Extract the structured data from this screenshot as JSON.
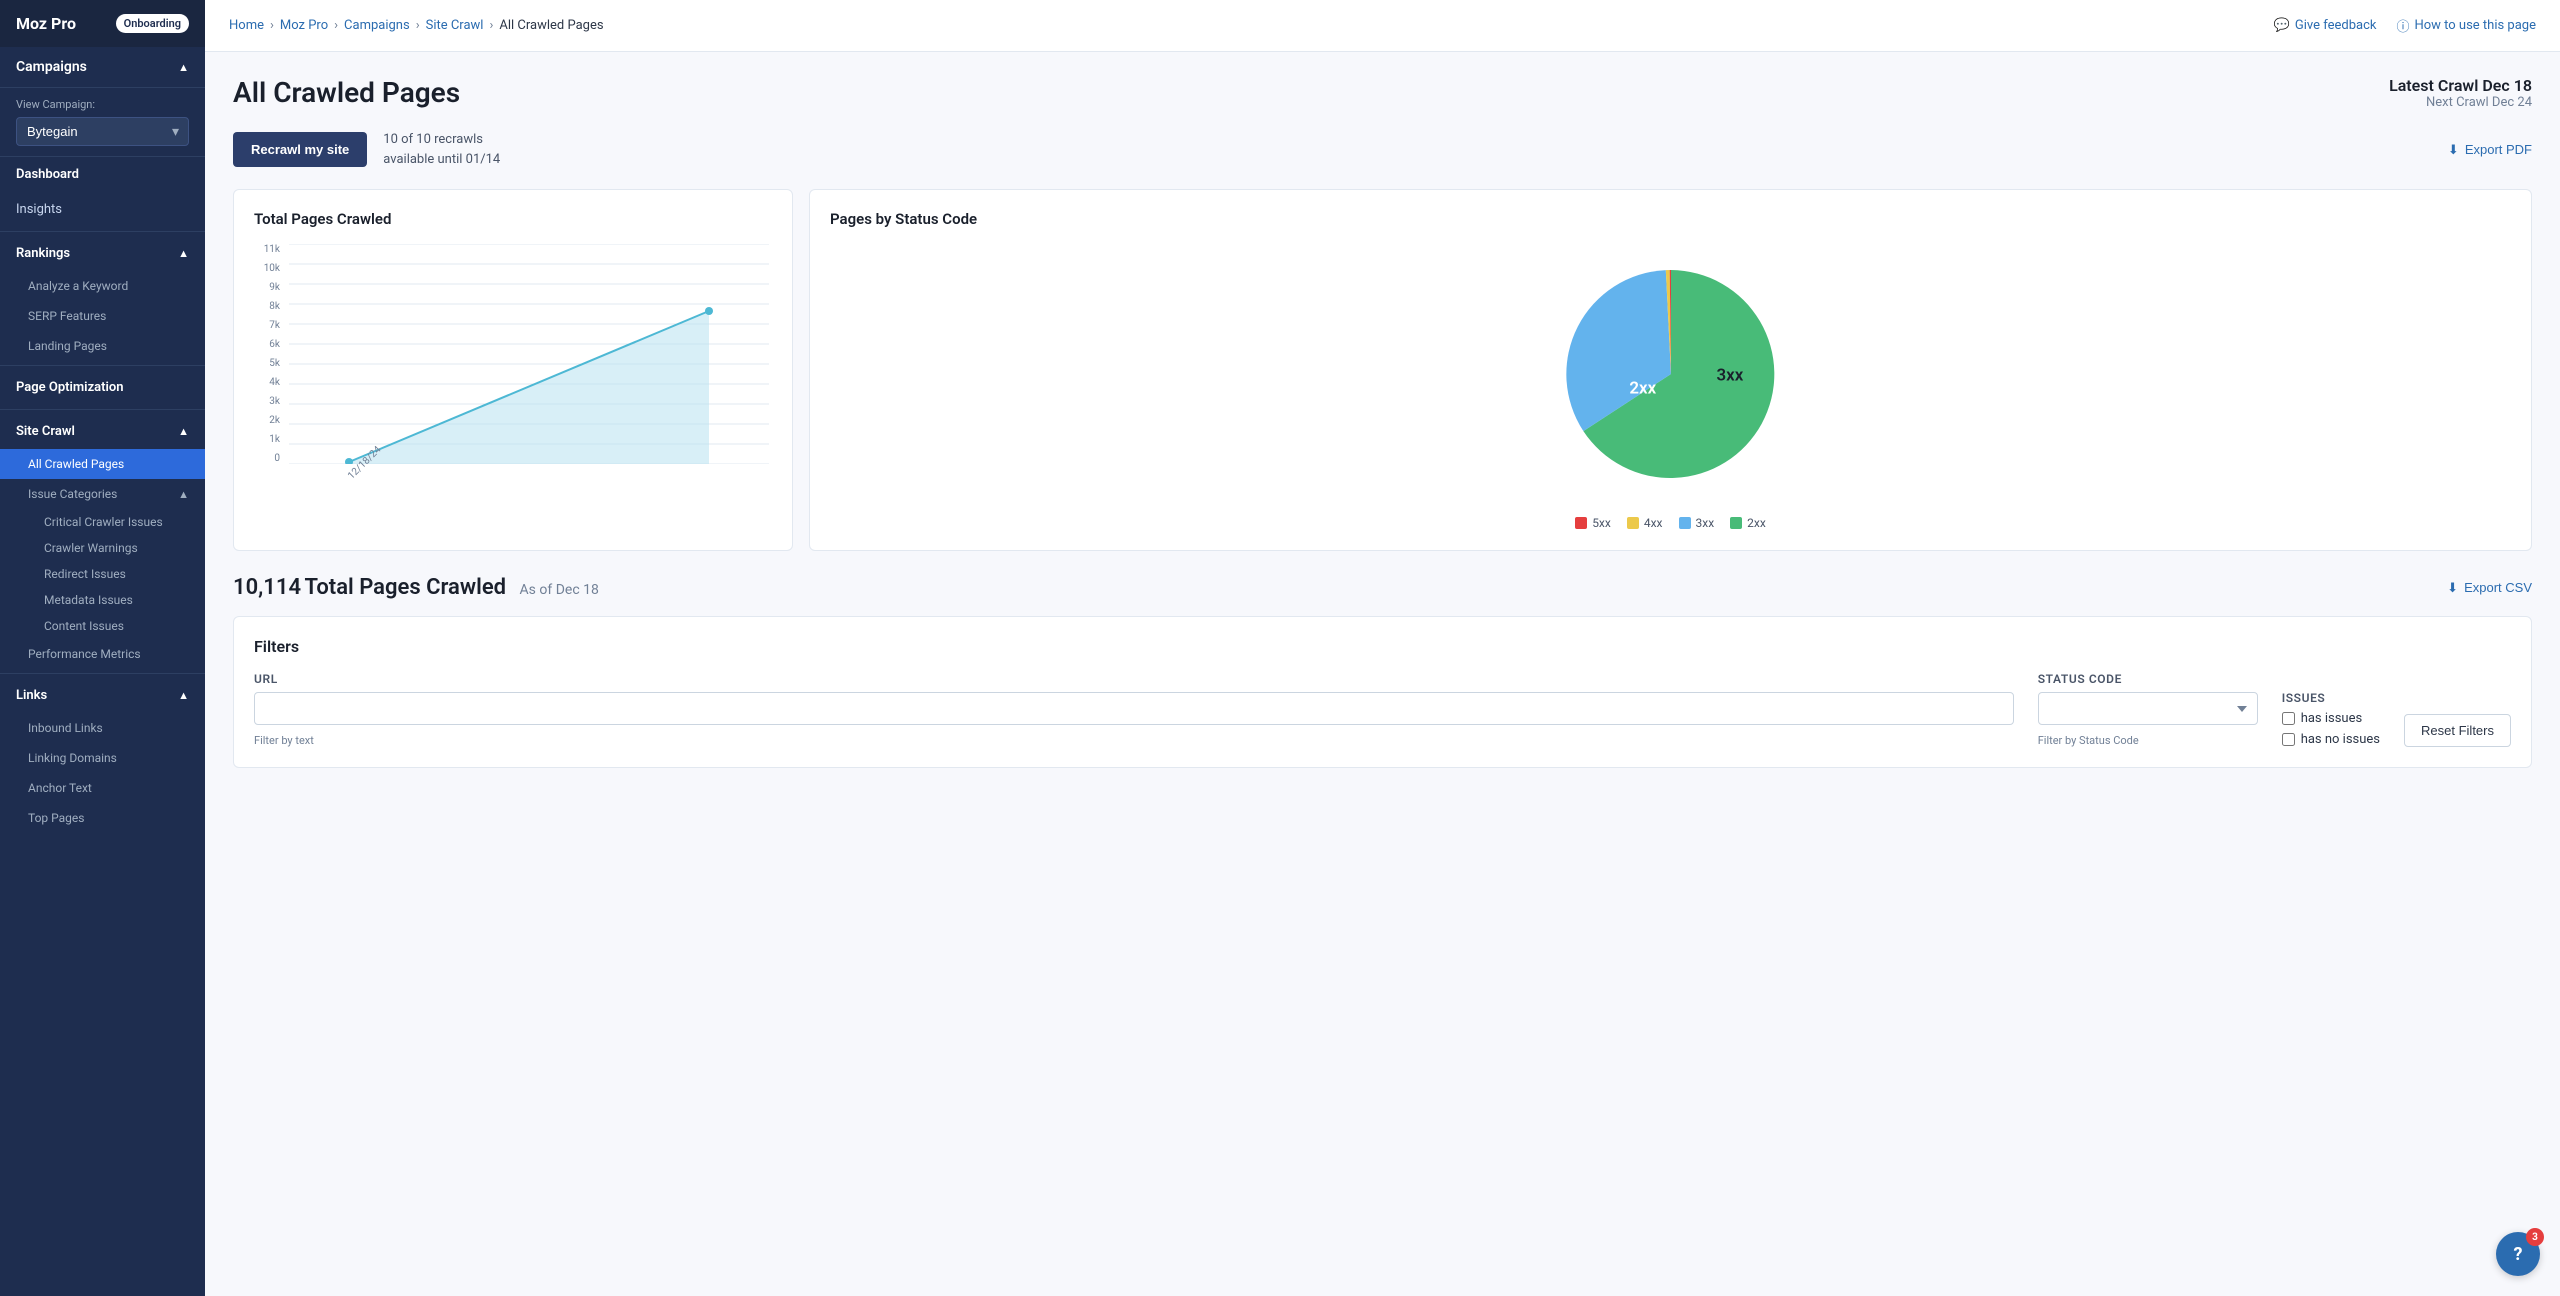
{
  "app": {
    "name": "Moz Pro",
    "onboarding_badge": "Onboarding"
  },
  "sidebar": {
    "campaigns_label": "Campaigns",
    "view_campaign_label": "View Campaign:",
    "campaign_name": "Bytegain",
    "nav_items": [
      {
        "id": "dashboard",
        "label": "Dashboard",
        "type": "item"
      },
      {
        "id": "insights",
        "label": "Insights",
        "type": "item"
      },
      {
        "id": "rankings",
        "label": "Rankings",
        "type": "section"
      },
      {
        "id": "analyze-keyword",
        "label": "Analyze a Keyword",
        "type": "subitem"
      },
      {
        "id": "serp-features",
        "label": "SERP Features",
        "type": "subitem"
      },
      {
        "id": "landing-pages",
        "label": "Landing Pages",
        "type": "subitem"
      },
      {
        "id": "page-optimization",
        "label": "Page Optimization",
        "type": "item"
      },
      {
        "id": "site-crawl",
        "label": "Site Crawl",
        "type": "section"
      },
      {
        "id": "all-crawled-pages",
        "label": "All Crawled Pages",
        "type": "subitem",
        "active": true
      },
      {
        "id": "issue-categories",
        "label": "Issue Categories",
        "type": "subitem"
      },
      {
        "id": "critical-crawler-issues",
        "label": "Critical Crawler Issues",
        "type": "sub-subitem"
      },
      {
        "id": "crawler-warnings",
        "label": "Crawler Warnings",
        "type": "sub-subitem"
      },
      {
        "id": "redirect-issues",
        "label": "Redirect Issues",
        "type": "sub-subitem"
      },
      {
        "id": "metadata-issues",
        "label": "Metadata Issues",
        "type": "sub-subitem"
      },
      {
        "id": "content-issues",
        "label": "Content Issues",
        "type": "sub-subitem"
      },
      {
        "id": "performance-metrics",
        "label": "Performance Metrics",
        "type": "subitem"
      },
      {
        "id": "links",
        "label": "Links",
        "type": "section"
      },
      {
        "id": "inbound-links",
        "label": "Inbound Links",
        "type": "subitem"
      },
      {
        "id": "linking-domains",
        "label": "Linking Domains",
        "type": "subitem"
      },
      {
        "id": "anchor-text",
        "label": "Anchor Text",
        "type": "subitem"
      },
      {
        "id": "top-pages",
        "label": "Top Pages",
        "type": "subitem"
      }
    ]
  },
  "topbar": {
    "breadcrumbs": [
      "Home",
      "Moz Pro",
      "Campaigns",
      "Site Crawl",
      "All Crawled Pages"
    ],
    "feedback_label": "Give feedback",
    "how_to_label": "How to use this page"
  },
  "page": {
    "title": "All Crawled Pages",
    "latest_crawl": "Latest Crawl Dec 18",
    "next_crawl": "Next Crawl Dec 24",
    "recrawl_button": "Recrawl my site",
    "recrawl_count": "10 of 10 recrawls",
    "recrawl_until": "available until 01/14",
    "export_pdf_label": "Export PDF",
    "export_csv_label": "Export CSV"
  },
  "line_chart": {
    "title": "Total Pages Crawled",
    "y_labels": [
      "11k",
      "10k",
      "9k",
      "8k",
      "7k",
      "6k",
      "5k",
      "4k",
      "3k",
      "2k",
      "1k",
      "0"
    ],
    "x_label": "12/18/24",
    "max_value": 11000,
    "data_value": 7800
  },
  "pie_chart": {
    "title": "Pages by Status Code",
    "slices": [
      {
        "label": "5xx",
        "color": "#e53e3e",
        "percentage": 1,
        "degrees": 3.6
      },
      {
        "label": "4xx",
        "color": "#ecc94b",
        "percentage": 2,
        "degrees": 7.2
      },
      {
        "label": "3xx",
        "color": "#63b3ed",
        "percentage": 40,
        "degrees": 144
      },
      {
        "label": "2xx",
        "color": "#48bb78",
        "percentage": 57,
        "degrees": 205.2
      }
    ]
  },
  "total_pages": {
    "count": "10,114",
    "label": "Total Pages Crawled",
    "date_label": "As of Dec 18"
  },
  "filters": {
    "title": "Filters",
    "url_label": "URL",
    "url_placeholder": "",
    "url_hint": "Filter by text",
    "status_code_label": "Status Code",
    "status_code_hint": "Filter by Status Code",
    "issues_label": "Issues",
    "has_issues_label": "has issues",
    "has_no_issues_label": "has no issues",
    "reset_button": "Reset Filters"
  },
  "help": {
    "count": "3",
    "icon": "?"
  }
}
